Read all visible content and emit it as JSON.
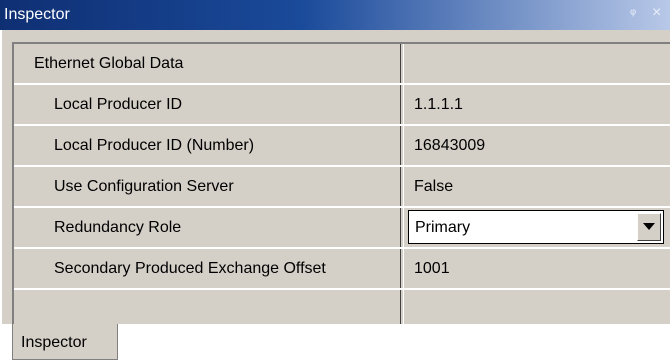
{
  "window": {
    "title": "Inspector",
    "pin_glyph": "ᵠ",
    "close_glyph": "×"
  },
  "properties": {
    "category": "Ethernet Global Data",
    "rows": [
      {
        "name": "Local Producer ID",
        "value": "1.1.1.1"
      },
      {
        "name": "Local Producer ID (Number)",
        "value": "16843009"
      },
      {
        "name": "Use Configuration Server",
        "value": "False"
      },
      {
        "name": "Redundancy Role",
        "value": "Primary"
      },
      {
        "name": "Secondary Produced Exchange Offset",
        "value": "1001"
      }
    ]
  },
  "tabs": [
    {
      "label": "Inspector"
    }
  ]
}
